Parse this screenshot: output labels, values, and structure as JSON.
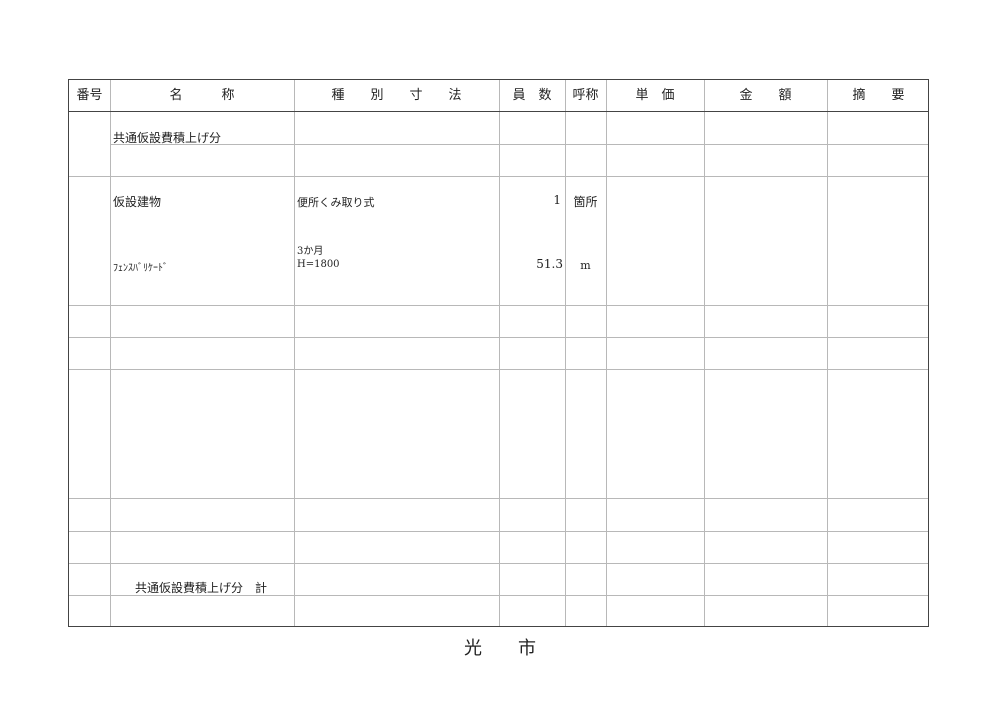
{
  "headers": {
    "number": "番号",
    "name": "名　　　称",
    "spec": "種　　別　　寸　　法",
    "quantity": "員　数",
    "unit": "呼称",
    "unit_price": "単　価",
    "amount": "金　　額",
    "remarks": "摘　　要"
  },
  "rows": {
    "section_title": "共通仮設費積上げ分",
    "item1": {
      "name": "仮設建物",
      "spec": "便所くみ取り式",
      "quantity": "1",
      "unit": "箇所"
    },
    "item2": {
      "name": "ﾌｪﾝｽﾊﾞﾘｹｰﾄﾞ",
      "spec_line1": "3か月",
      "spec_line2": "H=1800",
      "quantity": "51.3",
      "unit": "m"
    },
    "subtotal": "共通仮設費積上げ分　計"
  },
  "footer": {
    "issuer": "光　　市"
  }
}
